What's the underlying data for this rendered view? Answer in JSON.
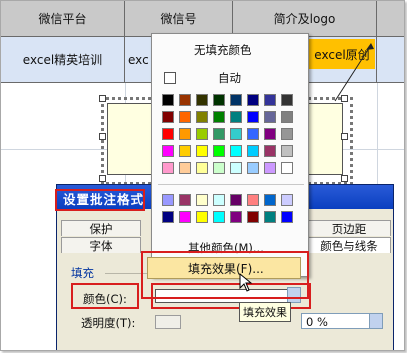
{
  "sheet": {
    "headers": [
      "微信平台",
      "微信号",
      "简介及logo"
    ],
    "row": [
      "excel精英培训",
      "exc",
      "excel原创"
    ]
  },
  "color_popup": {
    "no_fill": "无填充颜色",
    "automatic": "自动",
    "more_colors": "其他颜色(M)...",
    "fill_effects": "填充效果(F)...",
    "palette": [
      [
        "#000000",
        "#993300",
        "#333300",
        "#003300",
        "#003366",
        "#000080",
        "#333399",
        "#333333"
      ],
      [
        "#800000",
        "#ff6600",
        "#808000",
        "#008000",
        "#008080",
        "#0000ff",
        "#666699",
        "#808080"
      ],
      [
        "#ff0000",
        "#ff9900",
        "#99cc00",
        "#339966",
        "#33cccc",
        "#3366ff",
        "#800080",
        "#969696"
      ],
      [
        "#ff00ff",
        "#ffcc00",
        "#ffff00",
        "#00ff00",
        "#00ffff",
        "#00ccff",
        "#993366",
        "#c0c0c0"
      ],
      [
        "#ff99cc",
        "#ffcc99",
        "#ffff99",
        "#ccffcc",
        "#ccffff",
        "#99ccff",
        "#cc99ff",
        "#ffffff"
      ]
    ],
    "palette_extra": [
      [
        "#9999ff",
        "#993366",
        "#ffffcc",
        "#ccffff",
        "#660066",
        "#ff8080",
        "#0066cc",
        "#ccccff"
      ],
      [
        "#000080",
        "#ff00ff",
        "#ffff00",
        "#00ffff",
        "#800080",
        "#800000",
        "#008080",
        "#0000ff"
      ]
    ]
  },
  "dialog": {
    "title": "设置批注格式",
    "tabs_row1": [
      "保护",
      "页边距"
    ],
    "tabs_row2": [
      "字体",
      "颜色与线条"
    ],
    "section_fill": "填充",
    "color_label": "颜色(C):",
    "transparency_label": "透明度(T):",
    "transparency_value": "0 %",
    "tooltip": "填充效果"
  }
}
